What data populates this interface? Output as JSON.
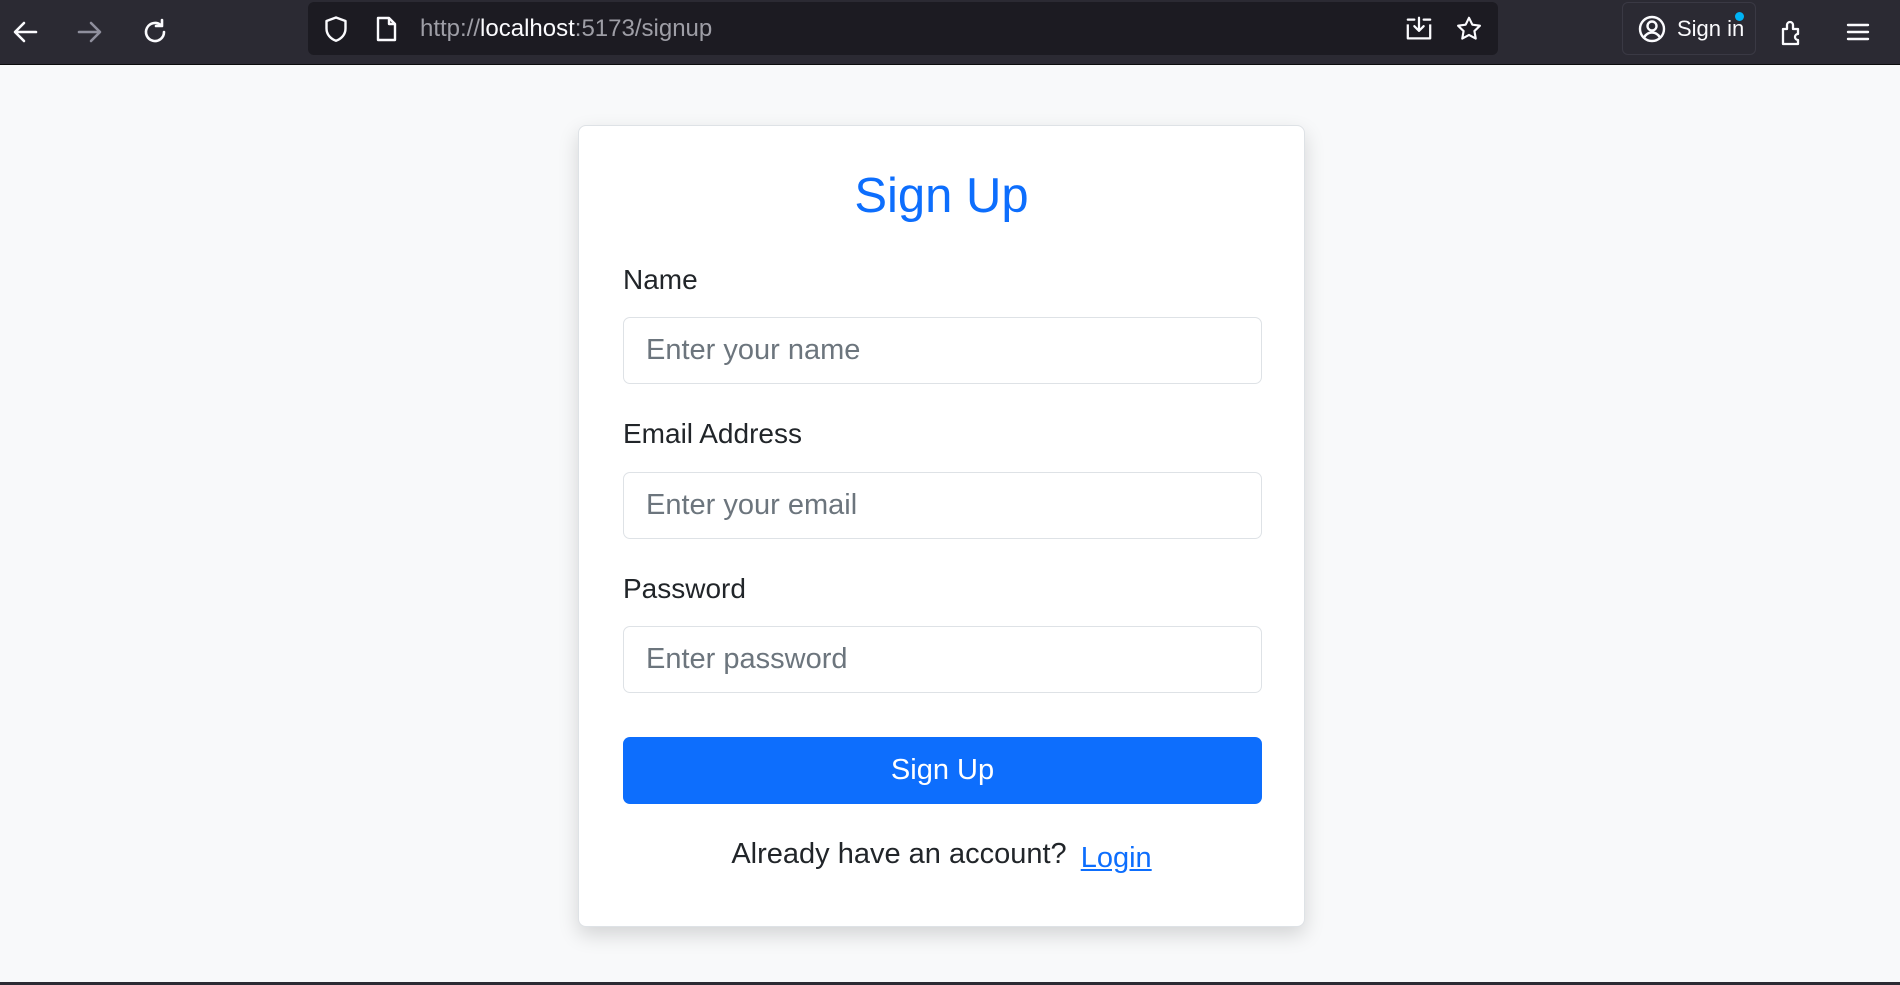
{
  "browser": {
    "url_scheme": "http://",
    "url_host": "localhost",
    "url_rest": ":5173/signup",
    "signin_label": "Sign in",
    "icons": {
      "back": "back-arrow-icon",
      "forward": "forward-arrow-icon",
      "reload": "reload-icon",
      "shield": "tracking-protection-shield-icon",
      "page": "page-icon",
      "save": "save-to-pocket-icon",
      "bookmark": "bookmark-star-icon",
      "account": "account-icon",
      "extensions": "extensions-icon",
      "menu": "hamburger-menu-icon"
    },
    "colors": {
      "toolbar": "#2b2a33",
      "urlbar": "#1c1b22",
      "notification_dot": "#00b3f4"
    }
  },
  "form": {
    "title": "Sign Up",
    "name_label": "Name",
    "name_placeholder": "Enter your name",
    "email_label": "Email Address",
    "email_placeholder": "Enter your email",
    "password_label": "Password",
    "password_placeholder": "Enter password",
    "submit_label": "Sign Up",
    "account_prompt": "Already have an account?",
    "login_link": "Login",
    "colors": {
      "primary": "#0d6efd",
      "text": "#212529",
      "page_background": "#f8f9fa"
    }
  }
}
